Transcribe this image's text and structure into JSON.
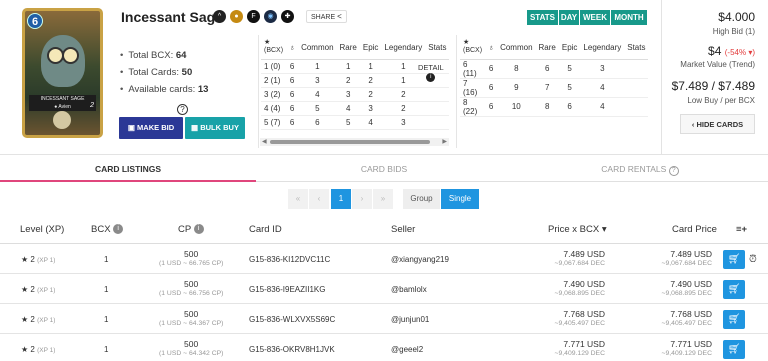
{
  "card": {
    "title": "Incessant Sage",
    "mana": "6",
    "art_name": "INCESSANT SAGE",
    "art_sub": "● Avien",
    "art_level": "2",
    "share_label": "SHARE",
    "icons": [
      "ability-icon",
      "gold-icon",
      "f-icon",
      "water-icon",
      "neutral-icon"
    ],
    "icon_glyphs": [
      "^",
      "●",
      "F",
      "◉",
      "✚"
    ]
  },
  "stats": {
    "bcx_label": "Total BCX:",
    "bcx_value": "64",
    "cards_label": "Total Cards:",
    "cards_value": "50",
    "avail_label": "Available cards:",
    "avail_value": "13"
  },
  "buttons": {
    "make_bid": "MAKE BID",
    "bulk_buy": "BULK BUY",
    "help": "?"
  },
  "stat_table_1": {
    "headers": [
      "(BCX)",
      "Common",
      "Rare",
      "Epic",
      "Legendary",
      "Stats"
    ],
    "star": "★",
    "rows": [
      [
        "1 (0)",
        "6",
        "1",
        "1",
        "1",
        "1"
      ],
      [
        "2 (1)",
        "6",
        "3",
        "2",
        "2",
        "1"
      ],
      [
        "3 (2)",
        "6",
        "4",
        "3",
        "2",
        "2"
      ],
      [
        "4 (4)",
        "6",
        "5",
        "4",
        "3",
        "2"
      ],
      [
        "5 (7)",
        "6",
        "6",
        "5",
        "4",
        "3"
      ]
    ],
    "detail_label": "DETAIL"
  },
  "stat_table_2": {
    "headers": [
      "(BCX)",
      "Common",
      "Rare",
      "Epic",
      "Legendary",
      "Stats"
    ],
    "star": "★",
    "rows": [
      [
        "6 (11)",
        "6",
        "8",
        "6",
        "5",
        "3"
      ],
      [
        "7 (16)",
        "6",
        "9",
        "7",
        "5",
        "4"
      ],
      [
        "8 (22)",
        "6",
        "10",
        "8",
        "6",
        "4"
      ]
    ]
  },
  "periods": [
    "STATS",
    "DAY",
    "WEEK",
    "MONTH"
  ],
  "prices": {
    "high_bid": "$4.000",
    "high_bid_label": "High Bid (1)",
    "market_value": "$4",
    "market_change": "(-54% ▾)",
    "market_label": "Market Value (Trend)",
    "low_buy": "$7.489 / $7.489",
    "low_buy_label": "Low Buy / per BCX",
    "hide_cards": "HIDE CARDS"
  },
  "tabs": [
    "CARD LISTINGS",
    "CARD BIDS",
    "CARD RENTALS"
  ],
  "pager": {
    "first": "«",
    "prev": "‹",
    "current": "1",
    "next": "›",
    "last": "»",
    "group": "Group",
    "single": "Single"
  },
  "listing": {
    "headers": {
      "level": "Level (XP)",
      "bcx": "BCX",
      "cp": "CP",
      "card_id": "Card ID",
      "seller": "Seller",
      "price_bcx": "Price x BCX",
      "card_price": "Card Price",
      "menu": "≡+"
    },
    "rows": [
      {
        "level": "2",
        "xp": "(XP 1)",
        "bcx": "1",
        "cp": "500",
        "cp_rate": "(1 USD ~ 66.765 CP)",
        "card_id": "G15-836-KI12DVC11C",
        "seller": "@xiangyang219",
        "price_usd": "7.489 USD",
        "price_dec": "~9,067.684 DEC",
        "card_usd": "7.489 USD",
        "card_dec": "~9,067.684 DEC"
      },
      {
        "level": "2",
        "xp": "(XP 1)",
        "bcx": "1",
        "cp": "500",
        "cp_rate": "(1 USD ~ 66.756 CP)",
        "card_id": "G15-836-I9EAZII1KG",
        "seller": "@bamlolx",
        "price_usd": "7.490 USD",
        "price_dec": "~9,068.895 DEC",
        "card_usd": "7.490 USD",
        "card_dec": "~9,068.895 DEC"
      },
      {
        "level": "2",
        "xp": "(XP 1)",
        "bcx": "1",
        "cp": "500",
        "cp_rate": "(1 USD ~ 64.367 CP)",
        "card_id": "G15-836-WLXVX5S69C",
        "seller": "@junjun01",
        "price_usd": "7.768 USD",
        "price_dec": "~9,405.497 DEC",
        "card_usd": "7.768 USD",
        "card_dec": "~9,405.497 DEC"
      },
      {
        "level": "2",
        "xp": "(XP 1)",
        "bcx": "1",
        "cp": "500",
        "cp_rate": "(1 USD ~ 64.342 CP)",
        "card_id": "G15-836-OKRV8H1JVK",
        "seller": "@geeel2",
        "price_usd": "7.771 USD",
        "price_dec": "~9,409.129 DEC",
        "card_usd": "7.771 USD",
        "card_dec": "~9,409.129 DEC"
      }
    ]
  }
}
